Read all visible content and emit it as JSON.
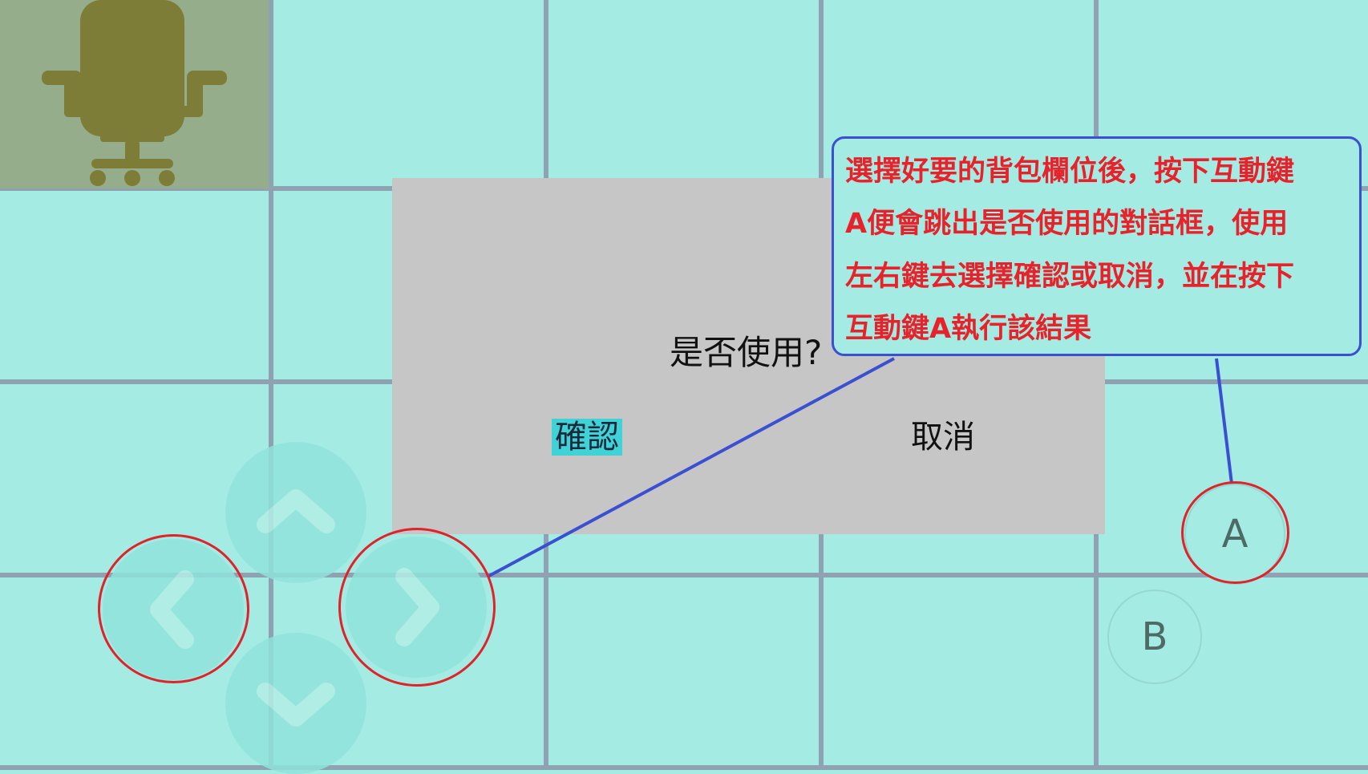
{
  "dialog": {
    "question": "是否使用?",
    "confirm_label": "確認",
    "cancel_label": "取消"
  },
  "controls": {
    "dpad": [
      "up",
      "down",
      "left",
      "right"
    ],
    "a_label": "A",
    "b_label": "B"
  },
  "callout": {
    "lines": [
      "選擇好要的背包欄位後，按下互動鍵",
      "A便會跳出是否使用的對話框，使用",
      "左右鍵去選擇確認或取消，並在按下",
      "互動鍵A執行該結果"
    ]
  },
  "colors": {
    "floor": "#a4ece3",
    "grid": "#8fa2b2",
    "dialog_bg": "#c6c6c6",
    "selected_highlight": "#3fd2d6",
    "annotation_text": "#e8222a",
    "annotation_border": "#3a4fd1",
    "highlight_ring": "#e0232a"
  },
  "icons": {
    "tile_item": "office-chair-icon",
    "dpad_up": "chevron-up-icon",
    "dpad_down": "chevron-down-icon",
    "dpad_left": "chevron-left-icon",
    "dpad_right": "chevron-right-icon"
  }
}
